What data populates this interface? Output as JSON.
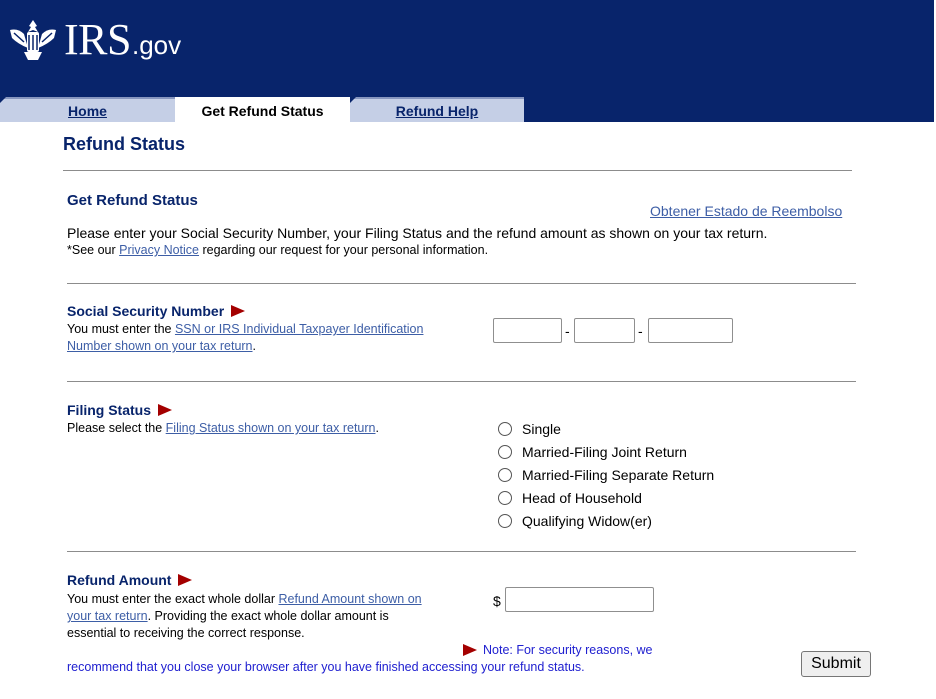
{
  "header": {
    "logo_main": "IRS",
    "logo_suffix": ".gov"
  },
  "tabs": [
    {
      "label": "Home",
      "active": false
    },
    {
      "label": "Get Refund Status",
      "active": true
    },
    {
      "label": "Refund Help",
      "active": false
    }
  ],
  "page": {
    "title": "Refund Status"
  },
  "section": {
    "title": "Get Refund Status",
    "spanish_link": "Obtener Estado de Reembolso",
    "intro": "Please enter your Social Security Number, your Filing Status and the refund amount as shown on your tax return.",
    "privacy_prefix": "*See our ",
    "privacy_link": "Privacy Notice",
    "privacy_suffix": " regarding our request for your personal information."
  },
  "ssn": {
    "title": "Social Security Number",
    "desc_prefix": "You must enter the ",
    "desc_link_1": "SSN or IRS Individual Taxpayer Identification",
    "desc_link_2": "Number shown on your tax return",
    "desc_suffix": ".",
    "separator": "-",
    "part1": "",
    "part2": "",
    "part3": ""
  },
  "filing": {
    "title": "Filing Status",
    "desc_prefix": "Please select the ",
    "desc_link": "Filing Status shown on your tax return",
    "desc_suffix": ".",
    "options": [
      "Single",
      "Married-Filing Joint Return",
      "Married-Filing Separate Return",
      "Head of Household",
      "Qualifying Widow(er)"
    ]
  },
  "refund": {
    "title": "Refund Amount",
    "desc_prefix": "You must enter the exact whole dollar ",
    "desc_link_1": "Refund Amount shown on",
    "desc_link_2": "your tax return",
    "desc_line2_suffix": ". Providing the exact whole dollar amount is",
    "desc_line3": "essential to receiving the correct response.",
    "currency": "$",
    "value": ""
  },
  "security_note": {
    "line1": "Note: For security reasons, we",
    "line2": "recommend that you close your browser after you have finished accessing your refund status."
  },
  "submit_label": "Submit",
  "colors": {
    "header_bg": "#08246b",
    "tab_bg": "#c5cfe6",
    "link": "#3d5ea6",
    "arrow": "#a40000",
    "note": "#2020d0"
  }
}
